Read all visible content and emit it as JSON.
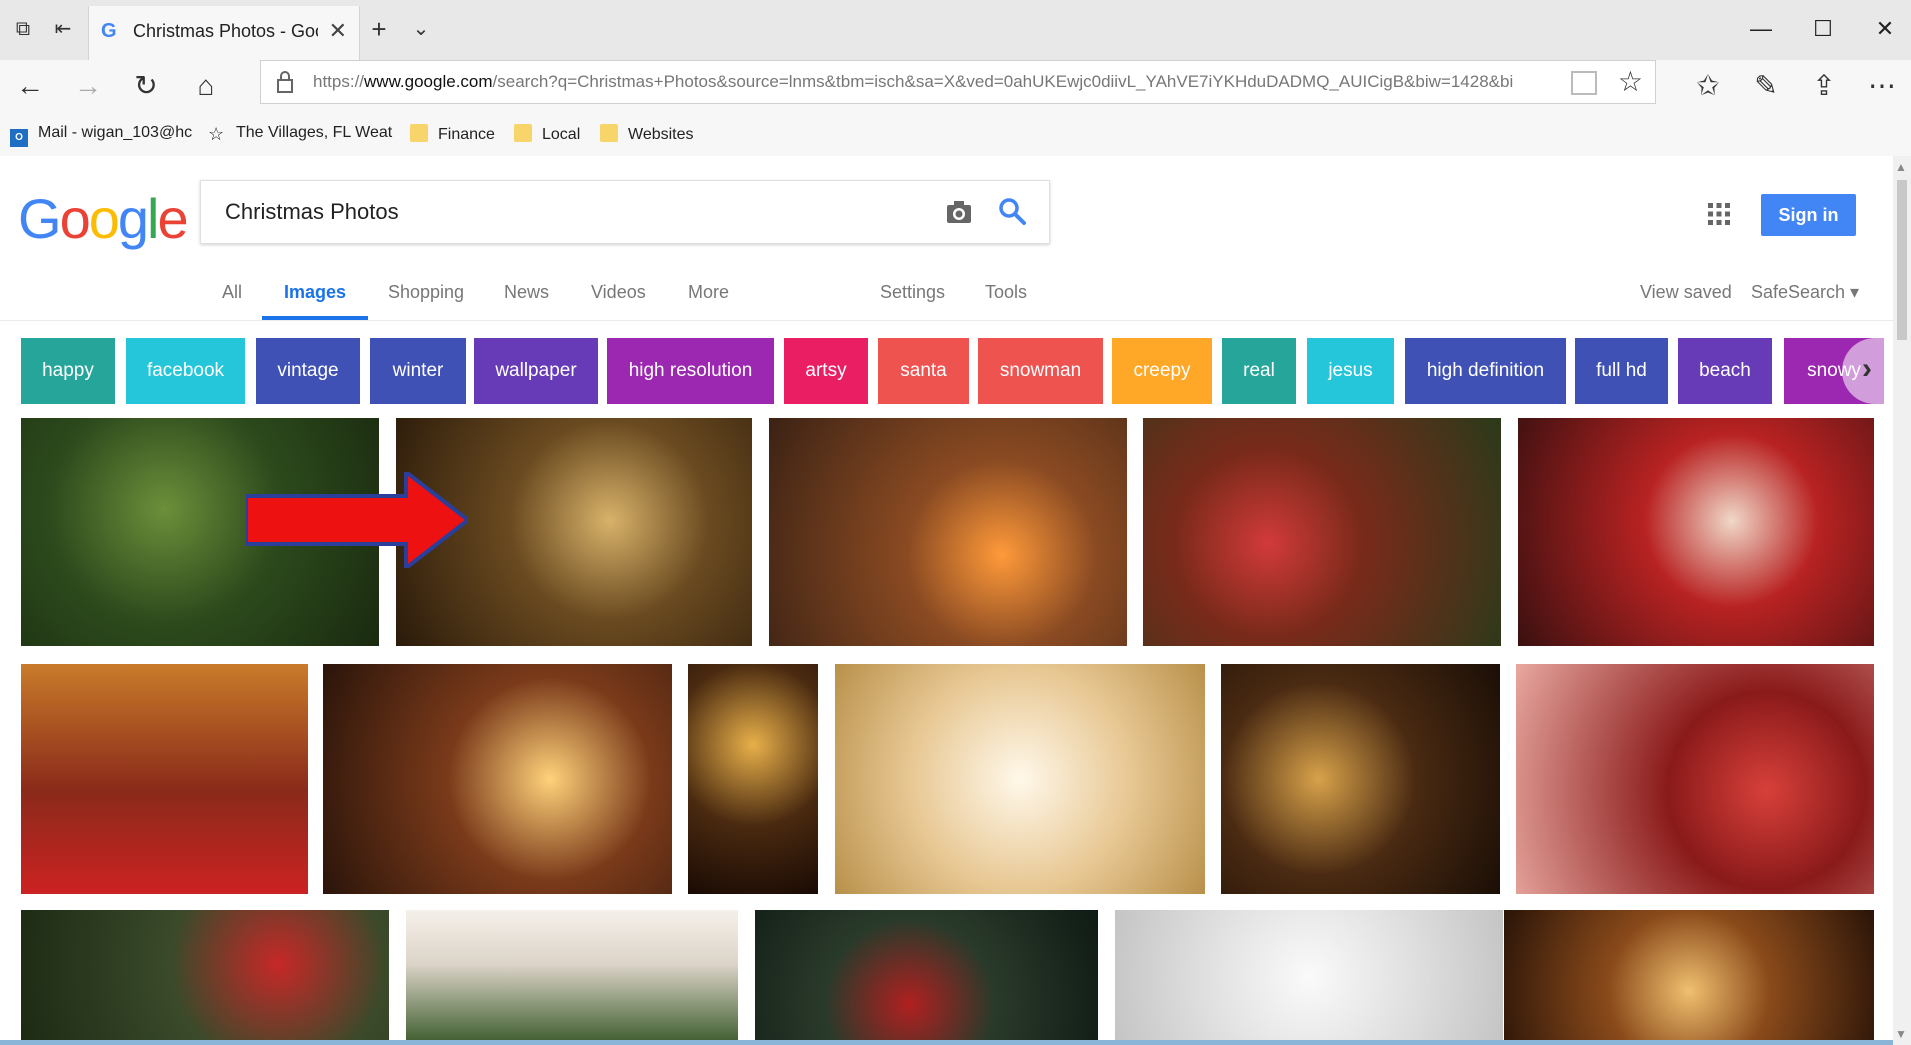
{
  "browser": {
    "tab_title": "Christmas Photos - Goo",
    "url_prefix": "https://",
    "url_host": "www.google.com",
    "url_path": "/search?q=Christmas+Photos&source=lnms&tbm=isch&sa=X&ved=0ahUKEwjc0diivL_YAhVE7iYKHduDADMQ_AUICigB&biw=1428&bih=",
    "bookmarks": [
      {
        "label": "Mail - wigan_103@hc",
        "icon": "outlook-icon"
      },
      {
        "label": "The Villages, FL Weat",
        "icon": "star-icon"
      },
      {
        "label": "Finance",
        "icon": "folder-icon"
      },
      {
        "label": "Local",
        "icon": "folder-icon"
      },
      {
        "label": "Websites",
        "icon": "folder-icon"
      }
    ]
  },
  "google": {
    "logo_letters": [
      "G",
      "o",
      "o",
      "g",
      "l",
      "e"
    ],
    "logo_colors": [
      "#4285f4",
      "#ea4335",
      "#fbbc05",
      "#4285f4",
      "#34a853",
      "#ea4335"
    ],
    "query": "Christmas Photos",
    "sign_in": "Sign in",
    "tabs": [
      "All",
      "Images",
      "Shopping",
      "News",
      "Videos",
      "More",
      "Settings",
      "Tools"
    ],
    "active_tab": "Images",
    "view_saved": "View saved",
    "safesearch": "SafeSearch ▾"
  },
  "chips": [
    {
      "label": "happy",
      "color": "#26a69a"
    },
    {
      "label": "facebook",
      "color": "#26c6da"
    },
    {
      "label": "vintage",
      "color": "#3f51b5"
    },
    {
      "label": "winter",
      "color": "#3f51b5"
    },
    {
      "label": "wallpaper",
      "color": "#673ab7"
    },
    {
      "label": "high resolution",
      "color": "#9c27b0"
    },
    {
      "label": "artsy",
      "color": "#e91e63"
    },
    {
      "label": "santa",
      "color": "#ef5350"
    },
    {
      "label": "snowman",
      "color": "#ef5350"
    },
    {
      "label": "creepy",
      "color": "#ffa726"
    },
    {
      "label": "real",
      "color": "#26a69a"
    },
    {
      "label": "jesus",
      "color": "#26c6da"
    },
    {
      "label": "high definition",
      "color": "#3f51b5"
    },
    {
      "label": "full hd",
      "color": "#3f51b5"
    },
    {
      "label": "beach",
      "color": "#673ab7"
    },
    {
      "label": "snowy",
      "color": "#9c27b0"
    }
  ],
  "images": [
    {
      "name": "christmas-tree-ornaments",
      "bg": "radial-gradient(circle at 40% 40%, #6b8f3a 0%, #2c4a1c 45%, #1a2a10 100%)"
    },
    {
      "name": "nativity-figurines",
      "bg": "radial-gradient(circle at 60% 45%, #d8b26a 0%, #6a4a20 40%, #2a1a0a 100%)"
    },
    {
      "name": "fireplace-christmas-tree",
      "bg": "radial-gradient(circle at 65% 60%, #ff9a3a 0%, #8a4a22 35%, #3b2214 100%)"
    },
    {
      "name": "red-swirl-ornament",
      "bg": "radial-gradient(circle at 35% 55%, #d23a3a 0%, #7a2a1a 35%, #2a3a1a 100%)"
    },
    {
      "name": "santa-claus",
      "bg": "radial-gradient(circle at 60% 45%, #f0d8c8 0%, #b82222 35%, #3a1010 100%)"
    },
    {
      "name": "christmas-stockings",
      "bg": "linear-gradient(180deg, #c97b2a 0%, #8a2a1a 55%, #cc2222 100%)"
    },
    {
      "name": "decorated-living-room",
      "bg": "radial-gradient(circle at 65% 50%, #ffd27a 0%, #7a3a1a 40%, #2a140a 100%)"
    },
    {
      "name": "children-by-tree",
      "bg": "radial-gradient(circle at 50% 35%, #e8b04a 0%, #4a2a10 50%, #1a0a04 100%)"
    },
    {
      "name": "snowman-illustration",
      "bg": "radial-gradient(circle at 50% 50%, #fff8ea 0%, #e8c894 50%, #b8904a 100%)"
    },
    {
      "name": "tree-and-fireplace",
      "bg": "radial-gradient(circle at 35% 50%, #d8a24a 0%, #4a2a12 45%, #1a0e06 100%)"
    },
    {
      "name": "red-bauble-closeup",
      "bg": "radial-gradient(circle at 70% 55%, #d8403a 0%, #8a1a1a 35%, #e8a8a0 100%)"
    },
    {
      "name": "tree-branch-bauble",
      "bg": "radial-gradient(circle at 70% 40%, #c62828 0%, #3a4a2a 40%, #1c2a14 100%)"
    },
    {
      "name": "candy-canes-garland",
      "bg": "linear-gradient(180deg, #f5f0ea 0%, #dcd4c8 40%, #3a5a2a 100%)"
    },
    {
      "name": "santa-in-forest",
      "bg": "radial-gradient(circle at 45% 70%, #b02020 0%, #2a3a2a 40%, #0e1a14 100%)"
    },
    {
      "name": "silver-bokeh",
      "bg": "radial-gradient(circle at 50% 50%, #fafafa 0%, #e0e0e0 50%, #c4c4c4 100%)"
    },
    {
      "name": "snowman-ornament-bokeh",
      "bg": "radial-gradient(circle at 50% 60%, #f0c070 0%, #8a4a1a 40%, #2a1408 100%)"
    }
  ]
}
